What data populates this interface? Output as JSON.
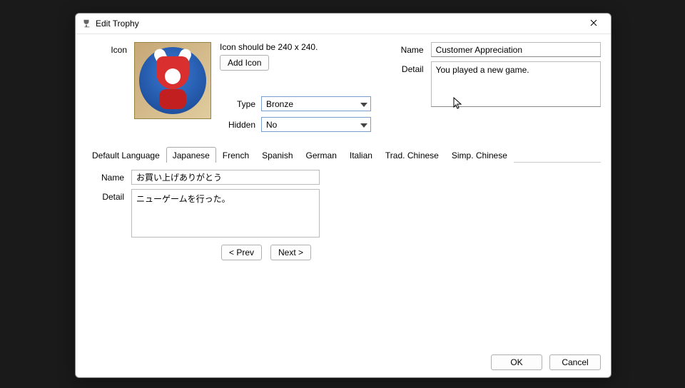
{
  "window": {
    "title": "Edit Trophy"
  },
  "icon": {
    "label": "Icon",
    "hint": "Icon should be 240 x 240.",
    "add_button": "Add Icon"
  },
  "type": {
    "label": "Type",
    "value": "Bronze"
  },
  "hidden": {
    "label": "Hidden",
    "value": "No"
  },
  "name": {
    "label": "Name",
    "value": "Customer Appreciation"
  },
  "detail": {
    "label": "Detail",
    "value": "You played a new game."
  },
  "tabs": {
    "0": "Default Language",
    "1": "Japanese",
    "2": "French",
    "3": "Spanish",
    "4": "German",
    "5": "Italian",
    "6": "Trad. Chinese",
    "7": "Simp. Chinese",
    "active_index": 1
  },
  "localized": {
    "name_label": "Name",
    "name_value": "お買い上げありがとう",
    "detail_label": "Detail",
    "detail_value": "ニューゲームを行った。"
  },
  "nav": {
    "prev": "< Prev",
    "next": "Next >"
  },
  "footer": {
    "ok": "OK",
    "cancel": "Cancel"
  }
}
